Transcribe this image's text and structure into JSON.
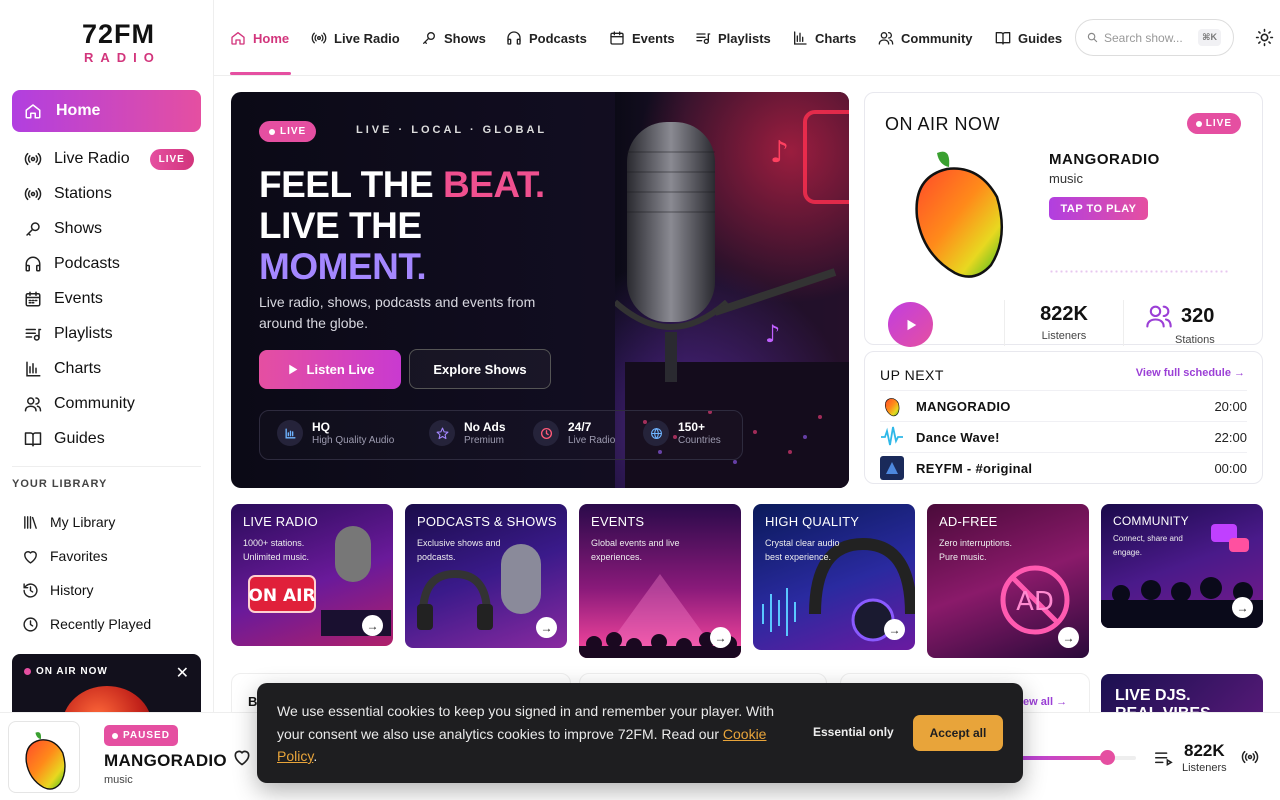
{
  "brand": {
    "name": "72FM",
    "sub": "RADIO"
  },
  "sidebar": {
    "home": "Home",
    "items": [
      {
        "label": "Live Radio",
        "icon": "radio-waves-icon",
        "badge": "LIVE"
      },
      {
        "label": "Stations",
        "icon": "radio-waves-icon"
      },
      {
        "label": "Shows",
        "icon": "mic-icon"
      },
      {
        "label": "Podcasts",
        "icon": "headphones-icon"
      },
      {
        "label": "Events",
        "icon": "calendar-icon"
      },
      {
        "label": "Playlists",
        "icon": "playlist-icon"
      },
      {
        "label": "Charts",
        "icon": "bar-chart-icon"
      },
      {
        "label": "Community",
        "icon": "users-icon"
      },
      {
        "label": "Guides",
        "icon": "book-icon"
      }
    ],
    "library_heading": "YOUR LIBRARY",
    "library": [
      {
        "label": "My Library",
        "icon": "library-icon"
      },
      {
        "label": "Favorites",
        "icon": "heart-icon"
      },
      {
        "label": "History",
        "icon": "history-icon"
      },
      {
        "label": "Recently Played",
        "icon": "clock-icon"
      }
    ],
    "onair_mini": {
      "label": "ON AIR NOW",
      "close": "✕"
    }
  },
  "topnav": {
    "items": [
      {
        "label": "Home",
        "icon": "home-icon"
      },
      {
        "label": "Live Radio",
        "icon": "radio-waves-icon"
      },
      {
        "label": "Shows",
        "icon": "mic-icon"
      },
      {
        "label": "Podcasts",
        "icon": "headphones-icon"
      },
      {
        "label": "Events",
        "icon": "calendar-icon"
      },
      {
        "label": "Playlists",
        "icon": "playlist-icon"
      },
      {
        "label": "Charts",
        "icon": "bar-chart-icon"
      },
      {
        "label": "Community",
        "icon": "users-icon"
      },
      {
        "label": "Guides",
        "icon": "book-icon"
      }
    ],
    "search_placeholder": "Search show...",
    "search_shortcut": "⌘K"
  },
  "hero": {
    "live": "LIVE",
    "tagline": "LIVE · LOCAL · GLOBAL",
    "line1_white": "FEEL THE ",
    "line1_pink": "BEAT.",
    "line2": "LIVE THE",
    "line3": "MOMENT.",
    "subtitle": "Live radio, shows, podcasts and events from around the globe.",
    "listen_btn": "Listen Live",
    "explore_btn": "Explore Shows",
    "features": [
      {
        "title": "HQ",
        "sub": "High Quality Audio",
        "icon": "bars-icon"
      },
      {
        "title": "No Ads",
        "sub": "Premium",
        "icon": "star-icon"
      },
      {
        "title": "24/7",
        "sub": "Live Radio",
        "icon": "clock-icon"
      },
      {
        "title": "150+",
        "sub": "Countries",
        "icon": "globe-icon"
      }
    ]
  },
  "onair": {
    "title": "ON AIR NOW",
    "live": "LIVE",
    "station": "MANGORADIO",
    "genre": "music",
    "tap": "TAP TO PLAY",
    "listeners_value": "822K",
    "listeners_label": "Listeners",
    "stations_value": "320",
    "stations_label": "Stations"
  },
  "upnext": {
    "title": "UP NEXT",
    "link": "View full schedule →",
    "rows": [
      {
        "name": "MANGORADIO",
        "time": "20:00"
      },
      {
        "name": "Dance Wave!",
        "time": "22:00"
      },
      {
        "name": "REYFM - #original",
        "time": "00:00"
      }
    ]
  },
  "tiles": [
    {
      "title": "LIVE RADIO",
      "desc": "1000+ stations. Unlimited music."
    },
    {
      "title": "PODCASTS & SHOWS",
      "desc": "Exclusive shows and podcasts."
    },
    {
      "title": "EVENTS",
      "desc": "Global events and live experiences."
    },
    {
      "title": "HIGH QUALITY",
      "desc": "Crystal clear audio best experience."
    },
    {
      "title": "AD-FREE",
      "desc": "Zero interruptions. Pure music."
    },
    {
      "title": "COMMUNITY",
      "desc": "Connect, share and engage."
    }
  ],
  "tile_art": {
    "onair_sign": "ON AIR",
    "adfree_sign": "AD"
  },
  "lower": {
    "first_letter": "B",
    "view_all": "iew all →",
    "djs_title": "LIVE DJS.",
    "djs_sub": "REAL VIBES."
  },
  "player": {
    "status": "PAUSED",
    "station": "MANGORADIO",
    "genre": "music",
    "volume": 0.77,
    "listeners_value": "822K",
    "listeners_label": "Listeners"
  },
  "cookie": {
    "text": "We use essential cookies to keep you signed in and remember your player. With your consent we also use analytics cookies to improve 72FM. Read our ",
    "link": "Cookie Policy",
    "end": ".",
    "essential": "Essential only",
    "accept": "Accept all"
  },
  "colors": {
    "accent_pink": "#e54fa1",
    "accent_purple": "#b13fe0",
    "cookie_button": "#e8a43a"
  }
}
